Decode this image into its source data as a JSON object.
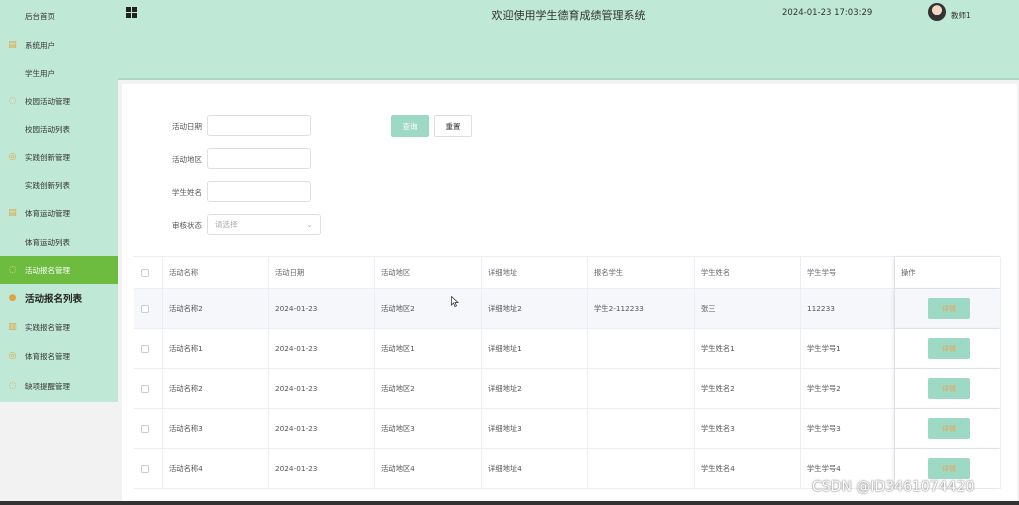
{
  "sidebar": {
    "items": [
      {
        "label": "后台首页",
        "icon": "none"
      },
      {
        "label": "系统用户",
        "icon": "document-icon"
      },
      {
        "label": "学生用户",
        "icon": "none"
      },
      {
        "label": "校园活动管理",
        "icon": "chat-icon"
      },
      {
        "label": "校园活动列表",
        "icon": "none"
      },
      {
        "label": "实践创新管理",
        "icon": "check-circle-icon"
      },
      {
        "label": "实践创新列表",
        "icon": "none"
      },
      {
        "label": "体育运动管理",
        "icon": "document-icon"
      },
      {
        "label": "体育运动列表",
        "icon": "none"
      },
      {
        "label": "活动报名管理",
        "icon": "chat-icon"
      },
      {
        "label": "活动报名列表",
        "icon": "location-icon"
      },
      {
        "label": "实践报名管理",
        "icon": "bar-chart-icon"
      },
      {
        "label": "体育报名管理",
        "icon": "check-circle-icon"
      },
      {
        "label": "缺项提醒管理",
        "icon": "chat-icon"
      }
    ]
  },
  "header": {
    "title": "欢迎使用学生德育成绩管理系统",
    "datetime": "2024-01-23 17:03:29",
    "username": "教师1"
  },
  "filters": {
    "date_label": "活动日期",
    "area_label": "活动地区",
    "name_label": "学生姓名",
    "status_label": "审核状态",
    "status_placeholder": "请选择",
    "search_label": "查询",
    "reset_label": "重置"
  },
  "table": {
    "columns": [
      "活动名称",
      "活动日期",
      "活动地区",
      "详细地址",
      "报名学生",
      "学生姓名",
      "学生学号",
      "操作"
    ],
    "detail_label": "详情",
    "rows": [
      [
        "活动名称2",
        "2024-01-23",
        "活动地区2",
        "详细地址2",
        "学生2-112233",
        "张三",
        "112233"
      ],
      [
        "活动名称1",
        "2024-01-23",
        "活动地区1",
        "详细地址1",
        "",
        "学生姓名1",
        "学生学号1"
      ],
      [
        "活动名称2",
        "2024-01-23",
        "活动地区2",
        "详细地址2",
        "",
        "学生姓名2",
        "学生学号2"
      ],
      [
        "活动名称3",
        "2024-01-23",
        "活动地区3",
        "详细地址3",
        "",
        "学生姓名3",
        "学生学号3"
      ],
      [
        "活动名称4",
        "2024-01-23",
        "活动地区4",
        "详细地址4",
        "",
        "学生姓名4",
        "学生学号4"
      ]
    ]
  },
  "watermark": "CSDN @ID3461074420",
  "colors": {
    "theme_mint": "#bfe8d6",
    "active_green": "#6dbb3f",
    "button_mint": "#9dd9c4",
    "detail_text_orange": "#f0a04b"
  }
}
